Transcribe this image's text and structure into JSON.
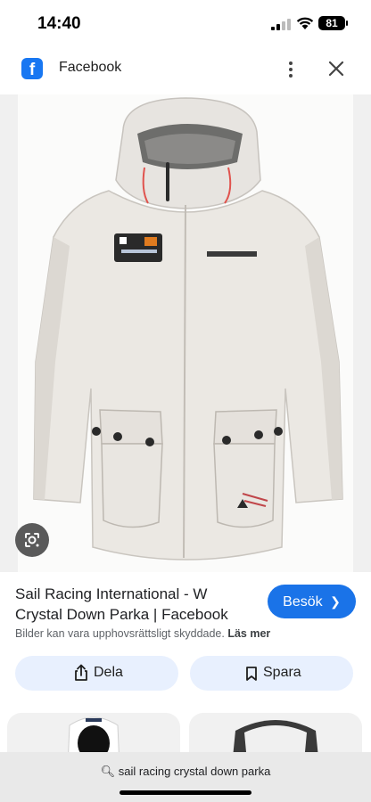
{
  "status_bar": {
    "time": "14:40",
    "battery": "81"
  },
  "header": {
    "title": "Facebook",
    "logo_letter": "f"
  },
  "result": {
    "title_line1": "Sail Racing International - W",
    "title_line2": "Crystal Down Parka | Facebook",
    "visit_label": "Besök",
    "copyright_text": "Bilder kan vara upphovsrättsligt skyddade.",
    "read_more": "Läs mer"
  },
  "actions": {
    "share_label": "Dela",
    "save_label": "Spara"
  },
  "search": {
    "query": "sail racing crystal down parka"
  },
  "colors": {
    "accent": "#1a73e8",
    "facebook": "#1877f2",
    "chip_bg": "#e8f0fe"
  }
}
